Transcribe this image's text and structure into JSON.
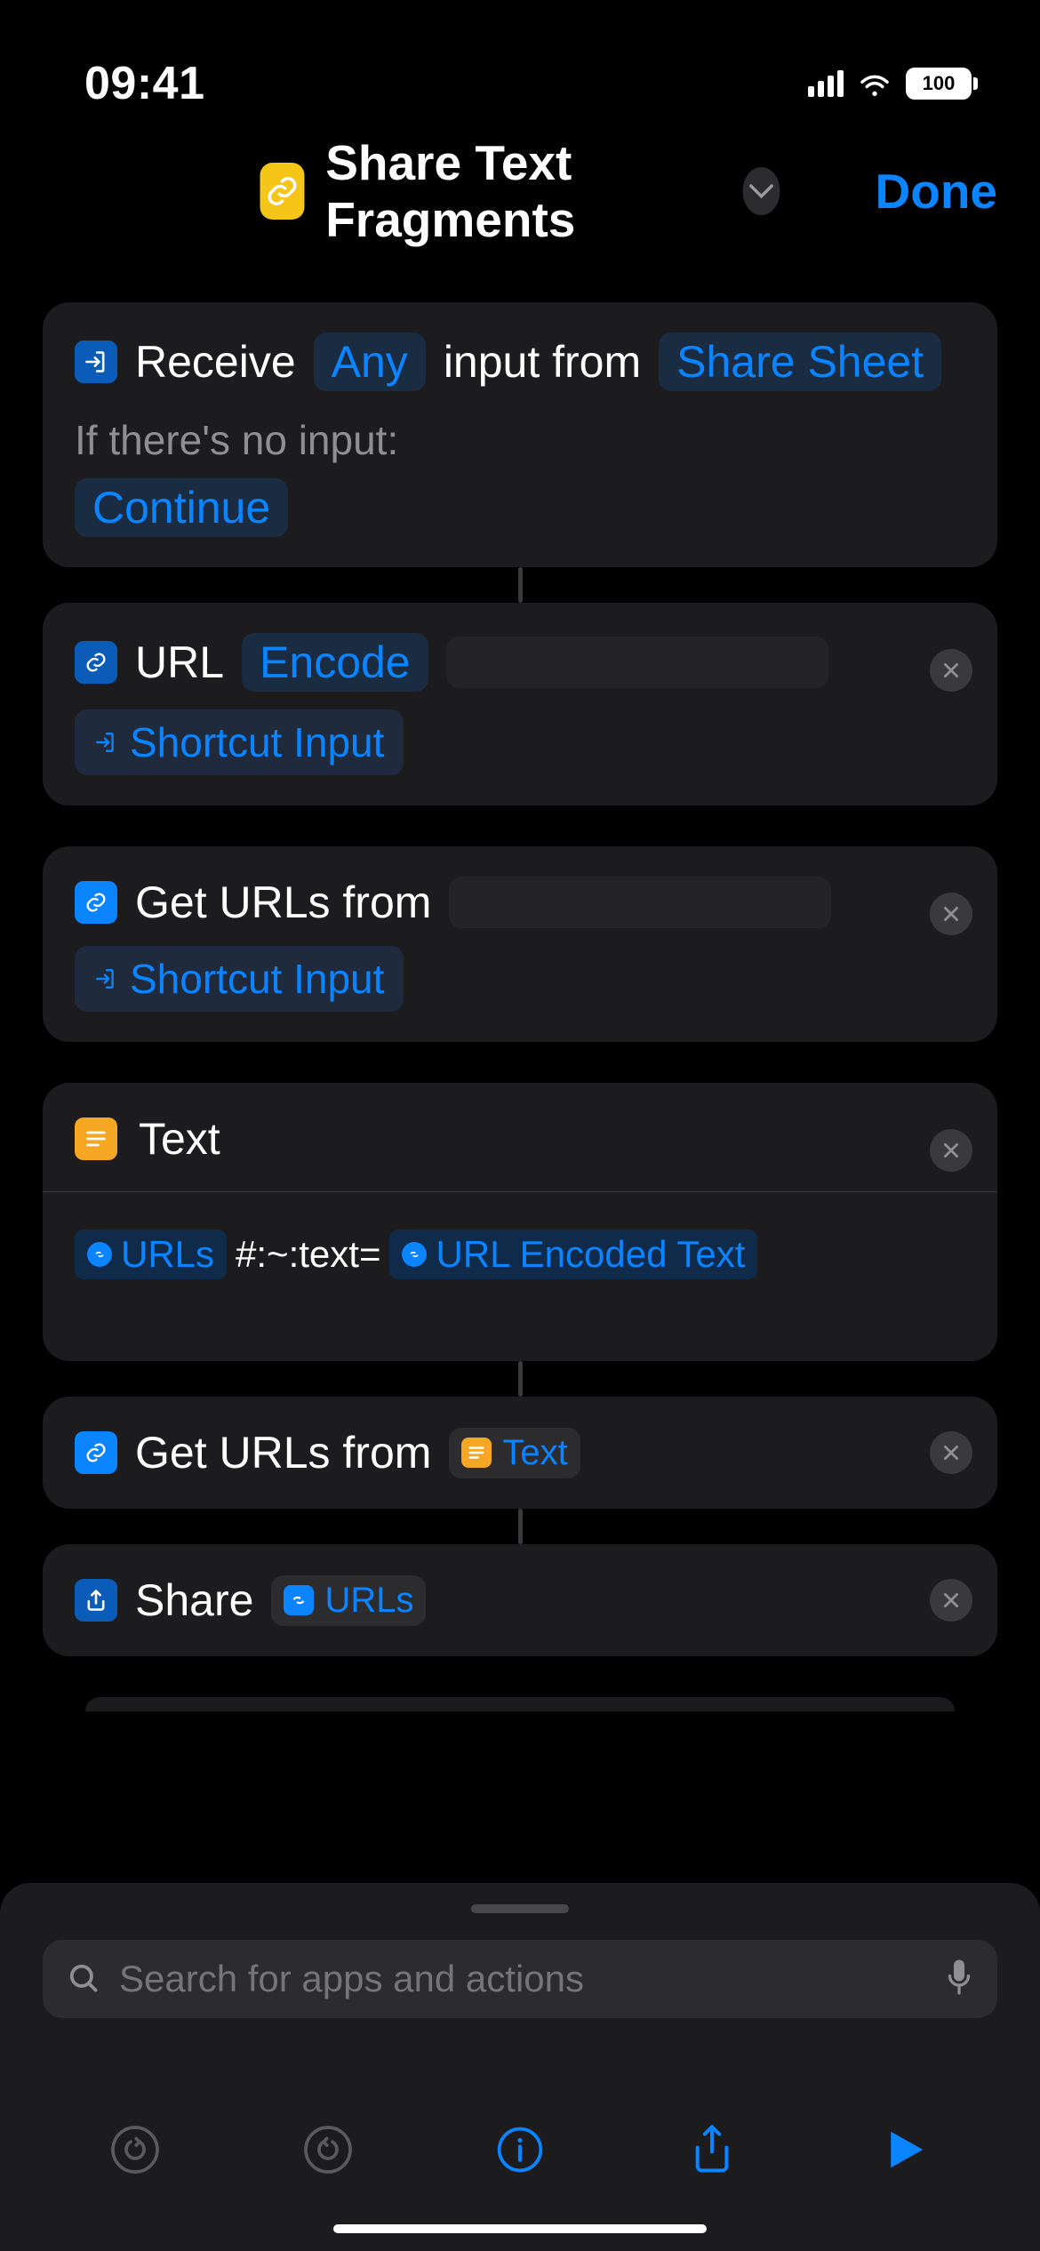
{
  "status": {
    "time": "09:41",
    "battery": "100"
  },
  "nav": {
    "title": "Share Text Fragments",
    "done": "Done"
  },
  "receive": {
    "word_receive": "Receive",
    "token_any": "Any",
    "word_inputfrom": "input from",
    "token_sharesheet": "Share Sheet",
    "no_input_label": "If there's no input:",
    "continue": "Continue"
  },
  "urlencode": {
    "title": "URL",
    "mode": "Encode",
    "var": "Shortcut Input"
  },
  "geturls1": {
    "title": "Get URLs from",
    "var": "Shortcut Input"
  },
  "text": {
    "title": "Text",
    "var1": "URLs",
    "literal": "#:~:text=",
    "var2": "URL Encoded Text"
  },
  "geturls2": {
    "title": "Get URLs from",
    "pill": "Text"
  },
  "share": {
    "title": "Share",
    "var": "URLs"
  },
  "search": {
    "placeholder": "Search for apps and actions"
  }
}
